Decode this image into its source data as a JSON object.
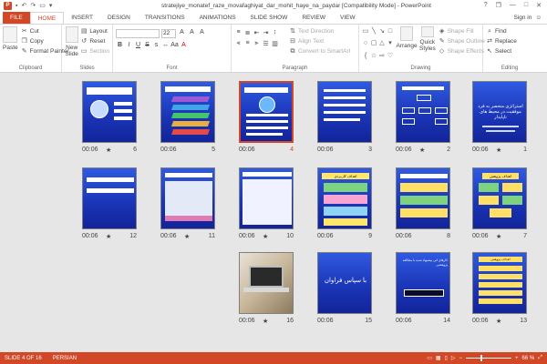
{
  "app": {
    "title": "stratejiye_monatef_raze_movafaghiyat_dar_mohit_haye_na_paydar [Compatibility Mode] - PowerPoint",
    "logo_letter": "P"
  },
  "window": {
    "help": "?",
    "restore": "❐",
    "minimize": "—",
    "maximize": "□",
    "close": "✕"
  },
  "tabs": [
    "FILE",
    "HOME",
    "INSERT",
    "DESIGN",
    "TRANSITIONS",
    "ANIMATIONS",
    "SLIDE SHOW",
    "REVIEW",
    "VIEW"
  ],
  "active_tab": "HOME",
  "sign_in": "Sign in",
  "ribbon": {
    "clipboard": {
      "paste": "Paste",
      "cut": "Cut",
      "copy": "Copy",
      "format_painter": "Format Painter",
      "label": "Clipboard"
    },
    "slides": {
      "new_slide": "New",
      "new_slide2": "Slide",
      "layout": "Layout",
      "reset": "Reset",
      "section": "Section",
      "label": "Slides"
    },
    "font": {
      "size": "22",
      "label": "Font",
      "bold": "B",
      "italic": "I",
      "underline": "U",
      "strike": "S",
      "aa_up": "A",
      "aa_down": "A",
      "clear": "A"
    },
    "paragraph": {
      "text_direction": "Text Direction",
      "align_text": "Align Text",
      "convert_smartart": "Convert to SmartArt",
      "label": "Paragraph"
    },
    "drawing": {
      "arrange": "Arrange",
      "quick_styles": "Quick",
      "quick_styles2": "Styles",
      "shape_fill": "Shape Fill",
      "shape_outline": "Shape Outline",
      "shape_effects": "Shape Effects",
      "label": "Drawing"
    },
    "editing": {
      "find": "Find",
      "replace": "Replace",
      "select": "Select",
      "label": "Editing"
    }
  },
  "slides": [
    {
      "num": "6",
      "duration": "00:06",
      "star": true
    },
    {
      "num": "5",
      "duration": "00:06",
      "star": false
    },
    {
      "num": "4",
      "duration": "00:06",
      "star": false,
      "selected": true
    },
    {
      "num": "3",
      "duration": "00:06",
      "star": false
    },
    {
      "num": "2",
      "duration": "00:06",
      "star": true
    },
    {
      "num": "1",
      "duration": "00:06",
      "star": true
    },
    {
      "num": "12",
      "duration": "00:06",
      "star": true
    },
    {
      "num": "11",
      "duration": "00:06",
      "star": true
    },
    {
      "num": "10",
      "duration": "00:06",
      "star": true
    },
    {
      "num": "9",
      "duration": "00:06",
      "star": false
    },
    {
      "num": "8",
      "duration": "00:06",
      "star": false
    },
    {
      "num": "7",
      "duration": "00:06",
      "star": true
    },
    {
      "num": "16",
      "duration": "00:06",
      "star": true
    },
    {
      "num": "15",
      "duration": "00:06",
      "star": false
    },
    {
      "num": "14",
      "duration": "00:06",
      "star": false
    },
    {
      "num": "13",
      "duration": "00:06",
      "star": true
    }
  ],
  "slide_text": {
    "s2": "استراتژی منحصر به فرد موفقیت در محیط های ناپایدار",
    "s7": "اهداف پژوهش",
    "s9": "اهداف کاربردی",
    "s13": "اهداف پژوهش",
    "s15": "با سپاس فراوان",
    "s14": "کارهای آتی پیشنهاد شده با مطالعه پژوهشی"
  },
  "status": {
    "slide": "SLIDE 4 OF 16",
    "language": "PERSIAN",
    "zoom": "66 %",
    "zoom_level": 0.66
  },
  "colors": {
    "accent": "#d24726",
    "slide_blue": "#1b36b8"
  }
}
